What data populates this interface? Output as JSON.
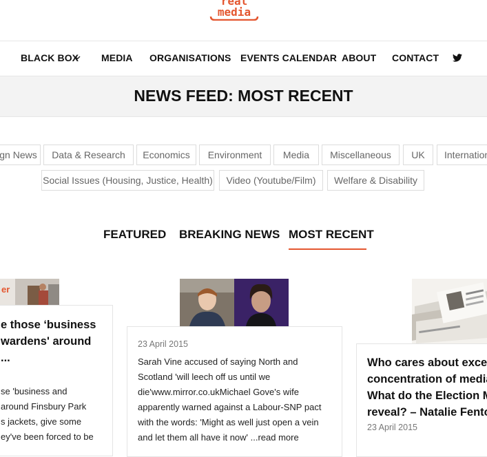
{
  "logo": {
    "line1": "real",
    "line2": "media"
  },
  "nav": {
    "items": [
      "BLACK BOX",
      "MEDIA",
      "ORGANISATIONS",
      "EVENTS CALENDAR",
      "ABOUT",
      "CONTACT"
    ],
    "twitter_icon": "twitter-icon"
  },
  "banner": {
    "title": "NEWS FEED: MOST RECENT"
  },
  "categories": {
    "row1": [
      "gn News",
      "Data & Research",
      "Economics",
      "Environment",
      "Media",
      "Miscellaneous",
      "UK",
      "Internation"
    ],
    "row2": [
      "Social Issues (Housing, Justice, Health)",
      "Video (Youtube/Film)",
      "Welfare & Disability"
    ]
  },
  "tabs": [
    "FEATURED",
    "BREAKING NEWS",
    "MOST RECENT"
  ],
  "active_tab": "MOST RECENT",
  "cards": [
    {
      "title_lines": [
        "e those ‘business",
        "wardens' around",
        "..."
      ],
      "excerpt_lines": [
        "se 'business and",
        "around Finsbury Park",
        "s jackets, give some",
        "ey've been forced to be"
      ]
    },
    {
      "date": "23 April 2015",
      "excerpt_lines": [
        "Sarah Vine accused of saying North and",
        "Scotland 'will leech off us until we",
        "die'www.mirror.co.ukMichael Gove's wife",
        "apparently warned against a Labour-SNP pact",
        "with the words: 'Might as well just open a vein",
        "and let them all have it now' ...read more"
      ]
    },
    {
      "title_lines": [
        "Who cares about exces",
        "concentration of media",
        "What do the Election M",
        "reveal? – Natalie Fento"
      ],
      "date": "23 April 2015"
    }
  ],
  "colors": {
    "accent": "#e4562f",
    "banner_bg": "#f3f3f3"
  }
}
